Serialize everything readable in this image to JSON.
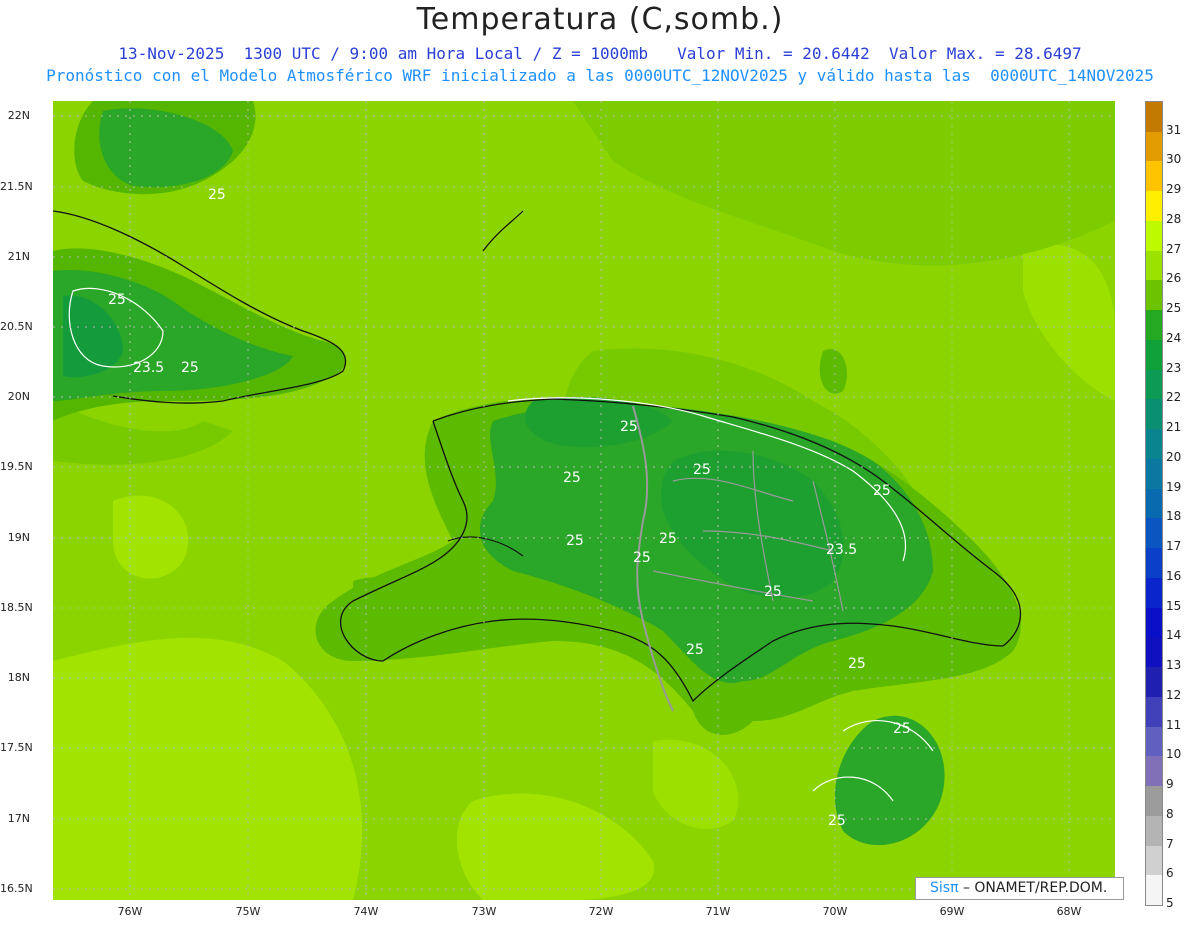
{
  "header": {
    "title": "Temperatura (C,somb.)",
    "line1": "13-Nov-2025  1300 UTC / 9:00 am Hora Local / Z = 1000mb   Valor Min. = 20.6442  Valor Max. = 28.6497",
    "line2": "Pronóstico con el Modelo Atmosférico WRF inicializado a las 0000UTC_12NOV2025 y válido hasta las  0000UTC_14NOV2025"
  },
  "map": {
    "lat_labels": [
      "22N",
      "21.5N",
      "21N",
      "20.5N",
      "20N",
      "19.5N",
      "19N",
      "18.5N",
      "18N",
      "17.5N",
      "17N",
      "16.5N"
    ],
    "lon_labels": [
      "76W",
      "75W",
      "74W",
      "73W",
      "72W",
      "71W",
      "70W",
      "69W",
      "68W"
    ],
    "contour_labels": [
      "25",
      "25",
      "23.5",
      "25",
      "25",
      "25",
      "25",
      "25",
      "25",
      "25",
      "23.5",
      "25",
      "25",
      "25",
      "25",
      "25",
      "25"
    ],
    "colors": {
      "sea_light": "#9ee000",
      "sea": "#82d200",
      "land_warm": "#5cba00",
      "land": "#2aa628",
      "land_cool": "#149b3c"
    }
  },
  "colorbar": {
    "labels": [
      "31",
      "30",
      "29",
      "28",
      "27",
      "26",
      "25",
      "24",
      "23",
      "22",
      "21",
      "20",
      "19",
      "18",
      "17",
      "16",
      "15",
      "14",
      "13",
      "12",
      "11",
      "10",
      "9",
      "8",
      "7",
      "6",
      "5"
    ],
    "colors": [
      "#c27a00",
      "#e29b00",
      "#ffc400",
      "#fff000",
      "#bdfa00",
      "#9be200",
      "#6cc300",
      "#25a822",
      "#10a03a",
      "#0c9a55",
      "#0a9070",
      "#0a8590",
      "#0a78a0",
      "#0a6ab0",
      "#0a55c0",
      "#0a3fc8",
      "#0a25cc",
      "#0a10c8",
      "#1010c0",
      "#2020b0",
      "#4040b8",
      "#6060c0",
      "#8070b8",
      "#9c9c9c",
      "#b4b4b4",
      "#d0d0d0",
      "#f5f5f5"
    ]
  },
  "credit": {
    "logo": "Sisπ",
    "text": "– ONAMET/REP.DOM."
  }
}
